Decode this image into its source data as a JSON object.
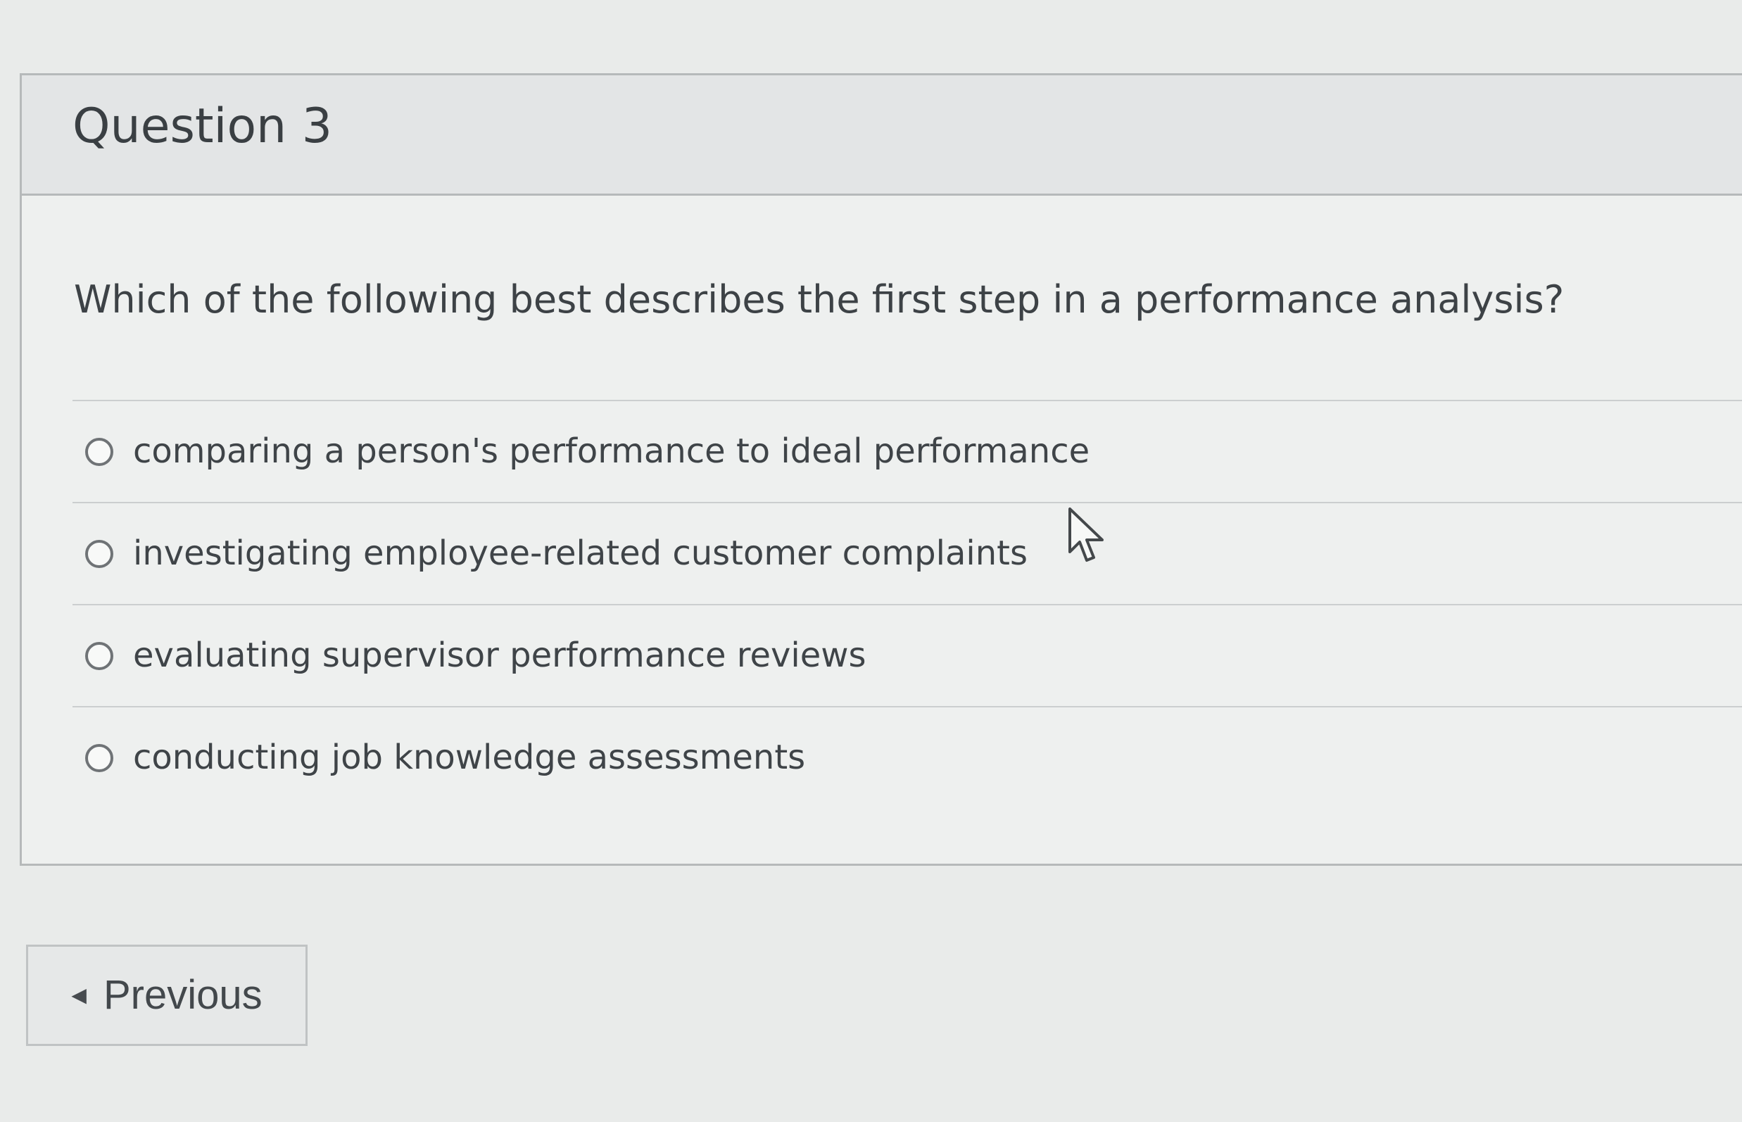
{
  "question": {
    "title": "Question 3",
    "prompt": "Which of the following best describes the first step in a performance analysis?",
    "options": [
      {
        "label": "comparing a person's performance to ideal performance"
      },
      {
        "label": "investigating employee-related customer complaints"
      },
      {
        "label": "evaluating supervisor performance reviews"
      },
      {
        "label": "conducting job knowledge assessments"
      }
    ]
  },
  "navigation": {
    "previous_label": "Previous",
    "previous_icon": "caret-left-icon"
  },
  "cursor": {
    "icon": "mouse-pointer-icon"
  }
}
